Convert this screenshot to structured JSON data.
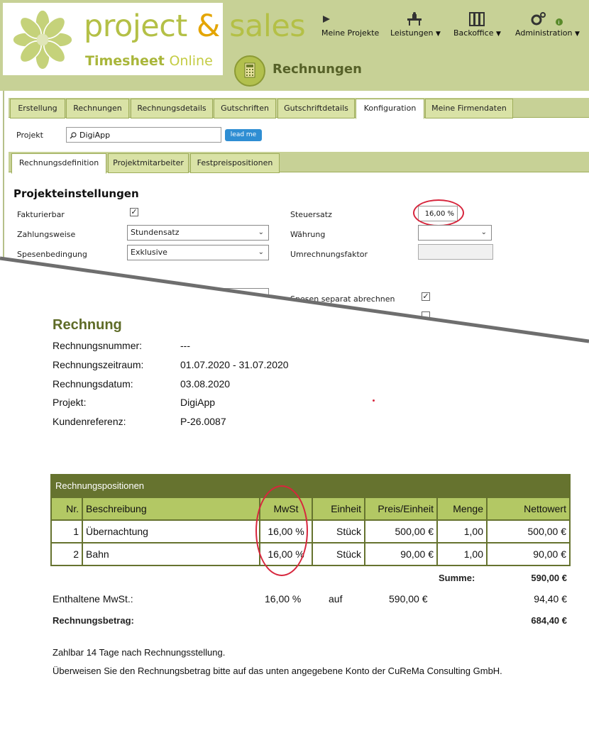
{
  "brand": {
    "name_part1": "project ",
    "amp": "&",
    "name_part2": " sales",
    "sub1": "Timesheet ",
    "sub2": "Online"
  },
  "topnav": [
    {
      "label": "Meine Projekte",
      "icon": "play-icon",
      "caret": ""
    },
    {
      "label": "Leistungen",
      "icon": "desk-icon",
      "caret": "▼"
    },
    {
      "label": "Backoffice",
      "icon": "binders-icon",
      "caret": "▼"
    },
    {
      "label": "Administration",
      "icon": "gears-icon",
      "caret": "▼"
    }
  ],
  "page": {
    "title": "Rechnungen",
    "icon": "calculator-icon"
  },
  "main_tabs": [
    "Erstellung",
    "Rechnungen",
    "Rechnungsdetails",
    "Gutschriften",
    "Gutschriftdetails",
    "Konfiguration",
    "Meine Firmendaten"
  ],
  "active_main_tab": "Konfiguration",
  "project_filter": {
    "label": "Projekt",
    "value": "DigiApp",
    "button": "lead me"
  },
  "sub_tabs": [
    "Rechnungsdefinition",
    "Projektmitarbeiter",
    "Festpreispositionen"
  ],
  "active_sub_tab": "Rechnungsdefinition",
  "settings": {
    "title": "Projekteinstellungen",
    "fakturierbar_label": "Fakturierbar",
    "fakturierbar_checked": "✓",
    "zahlungsweise_label": "Zahlungsweise",
    "zahlungsweise_value": "Stundensatz",
    "spesen_label": "Spesenbedingung",
    "spesen_value": "Exklusive",
    "steuersatz_label": "Steuersatz",
    "steuersatz_value": "16,00 %",
    "waehrung_label": "Währung",
    "waehrung_value": "",
    "umrechnung_label": "Umrechnungsfaktor",
    "spesen_separat_label": "Spesen separat abrechnen",
    "spesen_separat_checked": "✓"
  },
  "invoice": {
    "title": "Rechnung",
    "fields": [
      {
        "key": "Rechnungsnummer:",
        "value": "---"
      },
      {
        "key": "Rechnungszeitraum:",
        "value": "01.07.2020 - 31.07.2020"
      },
      {
        "key": "Rechnungsdatum:",
        "value": "03.08.2020"
      },
      {
        "key": "Projekt:",
        "value": "DigiApp"
      },
      {
        "key": "Kundenreferenz:",
        "value": "P-26.0087"
      }
    ],
    "table_title": "Rechnungspositionen",
    "columns": [
      "Nr.",
      "Beschreibung",
      "MwSt",
      "Einheit",
      "Preis/Einheit",
      "Menge",
      "Nettowert"
    ],
    "rows": [
      [
        "1",
        "Übernachtung",
        "16,00 %",
        "Stück",
        "500,00 €",
        "1,00",
        "500,00 €"
      ],
      [
        "2",
        "Bahn",
        "16,00 %",
        "Stück",
        "90,00 €",
        "1,00",
        "90,00 €"
      ]
    ],
    "sum_label": "Summe:",
    "sum_value": "590,00 €",
    "mwst_label": "Enthaltene MwSt.:",
    "mwst_rate": "16,00 %",
    "mwst_auf": "auf",
    "mwst_base": "590,00 €",
    "mwst_amount": "94,40 €",
    "total_label": "Rechnungsbetrag:",
    "total_value": "684,40 €",
    "footer": [
      "Zahlbar 14 Tage nach Rechnungsstellung.",
      "Überweisen Sie den Rechnungsbetrag bitte auf das unten angegebene Konto der CuReMa Consulting GmbH."
    ]
  },
  "colors": {
    "brand_green": "#b4c046",
    "brand_orange": "#e4a500",
    "table_dark": "#66732f",
    "table_head": "#b3c864",
    "highlight": "#d7263d"
  }
}
